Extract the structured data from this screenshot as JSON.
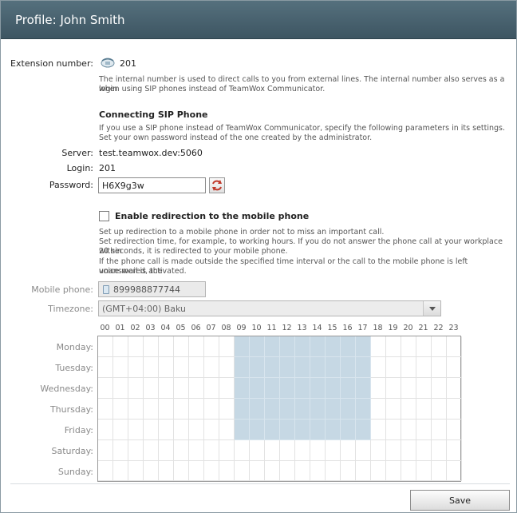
{
  "window": {
    "title": "Profile: John Smith"
  },
  "extension": {
    "label": "Extension number:",
    "value": "201",
    "icon": "phone-icon",
    "hint_line1": "The internal number is used to direct calls to you from external lines. The internal number also serves as a login",
    "hint_line2": "when using SIP phones instead of TeamWox Communicator."
  },
  "sip": {
    "heading": "Connecting SIP Phone",
    "hint_line1": "If you use a SIP phone instead of TeamWox Communicator, specify the following parameters in its settings.",
    "hint_line2": "Set your own password instead of the one created by the administrator.",
    "server_label": "Server:",
    "server_value": "test.teamwox.dev:5060",
    "login_label": "Login:",
    "login_value": "201",
    "password_label": "Password:",
    "password_value": "H6X9g3w",
    "regenerate_icon": "refresh-icon"
  },
  "redirection": {
    "checkbox_label": "Enable redirection to the mobile phone",
    "checked": false,
    "hint_line1": "Set up redirection to a mobile phone in order not to miss an important call.",
    "hint_line2": "Set redirection time, for example, to working hours. If you do not answer the phone call at your workplace within",
    "hint_line3": "20 seconds, it is redirected to your mobile phone.",
    "hint_line4": "If the phone call is made outside the specified time interval or the call to the mobile phone is left unanswered, the",
    "hint_line5": "voice mail is activated.",
    "mobile_label": "Mobile phone:",
    "mobile_value": "899988877744",
    "timezone_label": "Timezone:",
    "timezone_value": "(GMT+04:00) Baku"
  },
  "schedule": {
    "hours": [
      "00",
      "01",
      "02",
      "03",
      "04",
      "05",
      "06",
      "07",
      "08",
      "09",
      "10",
      "11",
      "12",
      "13",
      "14",
      "15",
      "16",
      "17",
      "18",
      "19",
      "20",
      "21",
      "22",
      "23"
    ],
    "days": [
      {
        "label": "Monday:",
        "active_hours": [
          9,
          10,
          11,
          12,
          13,
          14,
          15,
          16,
          17
        ]
      },
      {
        "label": "Tuesday:",
        "active_hours": [
          9,
          10,
          11,
          12,
          13,
          14,
          15,
          16,
          17
        ]
      },
      {
        "label": "Wednesday:",
        "active_hours": [
          9,
          10,
          11,
          12,
          13,
          14,
          15,
          16,
          17
        ]
      },
      {
        "label": "Thursday:",
        "active_hours": [
          9,
          10,
          11,
          12,
          13,
          14,
          15,
          16,
          17
        ]
      },
      {
        "label": "Friday:",
        "active_hours": [
          9,
          10,
          11,
          12,
          13,
          14,
          15,
          16,
          17
        ]
      },
      {
        "label": "Saturday:",
        "active_hours": []
      },
      {
        "label": "Sunday:",
        "active_hours": []
      }
    ],
    "active_color": "#c6d8e4"
  },
  "footer": {
    "save_label": "Save"
  }
}
